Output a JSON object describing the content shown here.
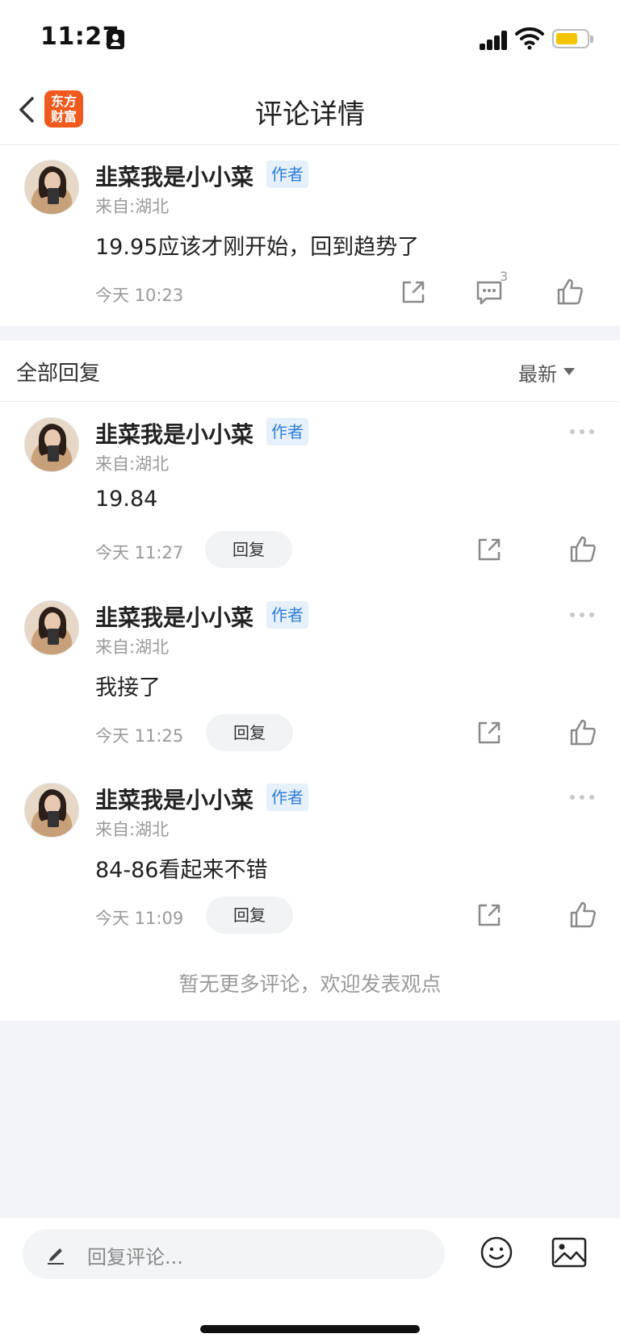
{
  "status_bar": {
    "time": "11:27"
  },
  "nav": {
    "title": "评论详情",
    "logo_line1": "东方",
    "logo_line2": "财富"
  },
  "main_comment": {
    "username": "韭菜我是小小菜",
    "tag": "作者",
    "location": "来自:湖北",
    "content": "19.95应该才刚开始，回到趋势了",
    "time": "今天 10:23",
    "reply_count": "3"
  },
  "replies_header": {
    "title": "全部回复",
    "sort": "最新"
  },
  "replies": [
    {
      "username": "韭菜我是小小菜",
      "tag": "作者",
      "location": "来自:湖北",
      "content": "19.84",
      "time": "今天 11:27",
      "reply_label": "回复"
    },
    {
      "username": "韭菜我是小小菜",
      "tag": "作者",
      "location": "来自:湖北",
      "content": "我接了",
      "time": "今天 11:25",
      "reply_label": "回复"
    },
    {
      "username": "韭菜我是小小菜",
      "tag": "作者",
      "location": "来自:湖北",
      "content": "84-86看起来不错",
      "time": "今天 11:09",
      "reply_label": "回复"
    }
  ],
  "footer_note": "暂无更多评论，欢迎发表观点",
  "bottom_bar": {
    "placeholder": "回复评论..."
  },
  "colors": {
    "brand": "#f05a1e",
    "tag_bg": "#e6f0fb",
    "tag_text": "#2f7fd8",
    "battery": "#f5c400"
  }
}
